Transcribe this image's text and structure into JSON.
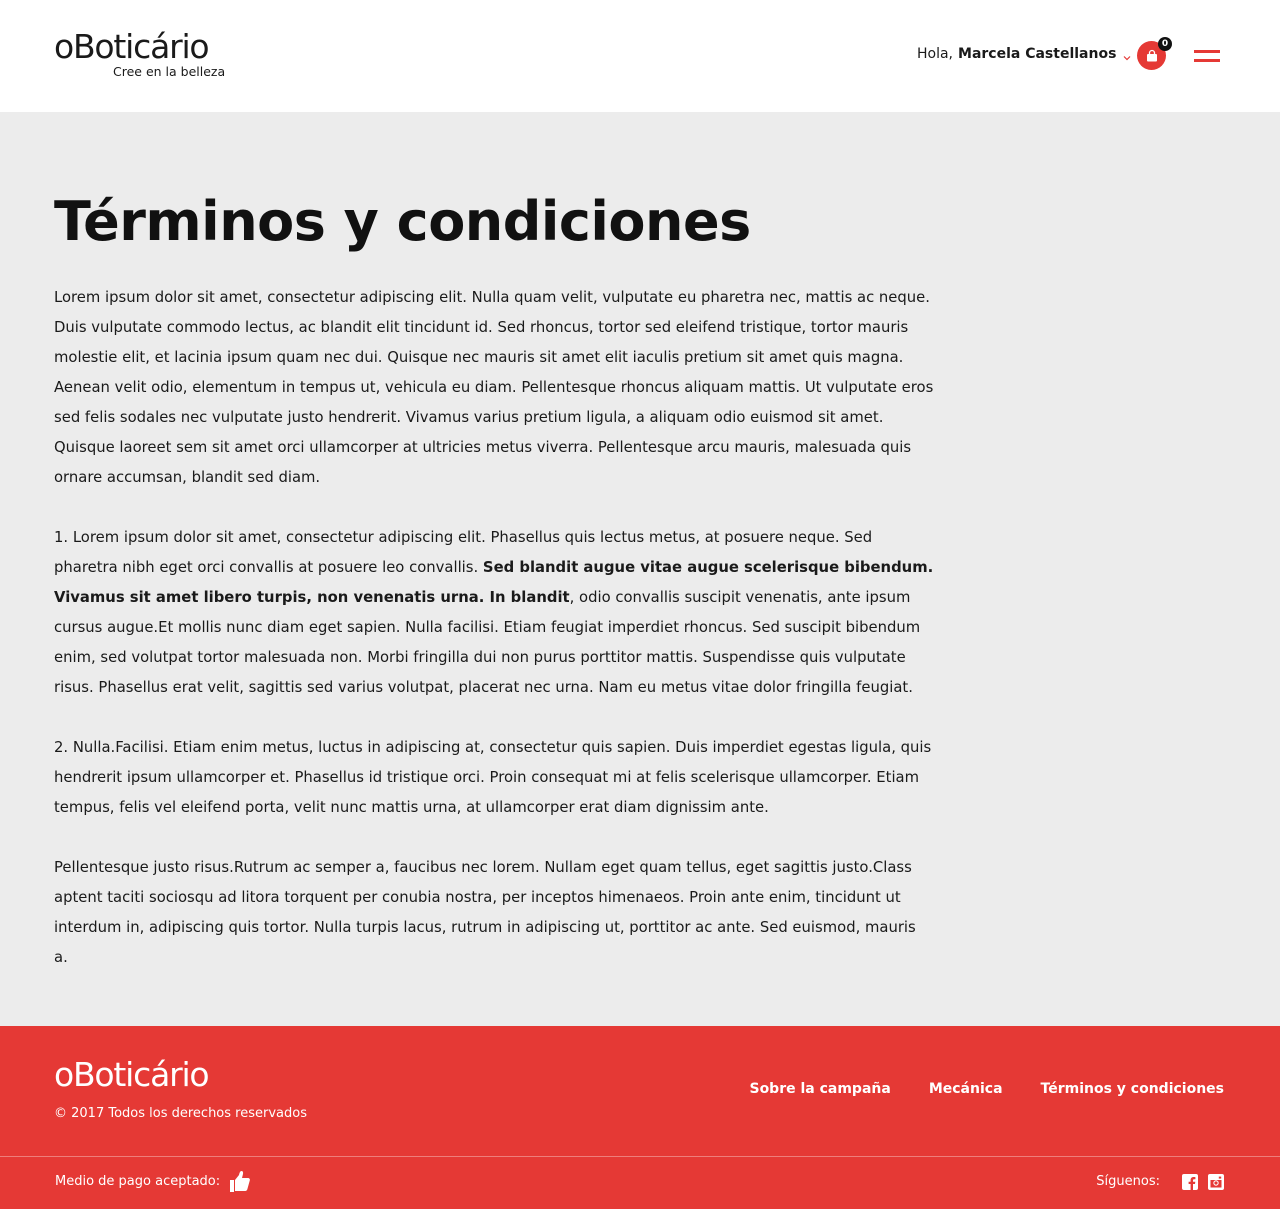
{
  "header": {
    "logo_text": "oBoticário",
    "logo_tagline": "Cree en la belleza",
    "greeting": "Hola,",
    "user_name": "Marcela Castellanos",
    "cart_count": "0"
  },
  "main": {
    "title": "Términos y condiciones",
    "paragraphs": {
      "p1": "Lorem ipsum dolor sit amet, consectetur adipiscing elit. Nulla quam velit, vulputate eu pharetra nec, mattis ac neque. Duis vulputate commodo lectus, ac blandit elit tincidunt id. Sed rhoncus, tortor sed eleifend tristique, tortor mauris molestie elit, et lacinia ipsum quam nec dui. Quisque nec mauris sit amet elit iaculis pretium sit amet quis magna. Aenean velit odio, elementum in tempus ut, vehicula eu diam. Pellentesque rhoncus aliquam mattis. Ut vulputate eros sed felis sodales nec vulputate justo hendrerit. Vivamus varius pretium ligula, a aliquam odio euismod sit amet. Quisque laoreet sem sit amet orci ullamcorper at ultricies metus viverra. Pellentesque arcu mauris, malesuada quis ornare accumsan, blandit sed diam.",
      "p2_start": "1. Lorem ipsum dolor sit amet, consectetur adipiscing elit. Phasellus quis lectus metus, at posuere neque. Sed pharetra nibh eget orci convallis at posuere leo convallis. ",
      "p2_bold": "Sed blandit augue vitae augue scelerisque bibendum. Vivamus sit amet libero turpis, non venenatis urna. In blandit",
      "p2_end": ", odio convallis suscipit venenatis, ante ipsum cursus augue.Et mollis nunc diam eget sapien. Nulla facilisi. Etiam feugiat imperdiet rhoncus. Sed suscipit bibendum enim, sed volutpat tortor malesuada non. Morbi fringilla dui non purus porttitor mattis. Suspendisse quis vulputate risus. Phasellus erat velit, sagittis sed varius volutpat, placerat nec urna. Nam eu metus vitae dolor fringilla feugiat.",
      "p3": "2. Nulla.Facilisi. Etiam enim metus, luctus in adipiscing at, consectetur quis sapien. Duis imperdiet egestas ligula, quis hendrerit ipsum ullamcorper et. Phasellus id tristique orci. Proin consequat mi at felis scelerisque ullamcorper. Etiam tempus, felis vel eleifend porta, velit nunc mattis urna, at ullamcorper erat diam dignissim ante.",
      "p4": "Pellentesque justo risus.Rutrum ac semper a, faucibus nec lorem. Nullam eget quam tellus, eget sagittis justo.Class aptent taciti sociosqu ad litora torquent per conubia nostra, per inceptos himenaeos. Proin ante enim, tincidunt ut interdum in, adipiscing quis tortor. Nulla turpis lacus, rutrum in adipiscing ut, porttitor ac ante. Sed euismod, mauris a."
    }
  },
  "footer": {
    "logo_text": "oBoticário",
    "copyright": "© 2017 Todos los derechos reservados",
    "nav": {
      "about": "Sobre la campaña",
      "mechanics": "Mecánica",
      "terms": "Términos y condiciones"
    },
    "payment_label": "Medio de pago aceptado:",
    "follow_label": "Síguenos:"
  },
  "colors": {
    "brand_red": "#e53935",
    "header_bg": "#ffffff",
    "page_bg": "#ececec"
  },
  "icons": {
    "user_menu": "chevron-down-icon",
    "cart": "shopping-bag-icon",
    "menu": "hamburger-menu-icon",
    "payment": "thumbs-up-icon",
    "facebook": "facebook-icon",
    "instagram": "instagram-icon"
  }
}
